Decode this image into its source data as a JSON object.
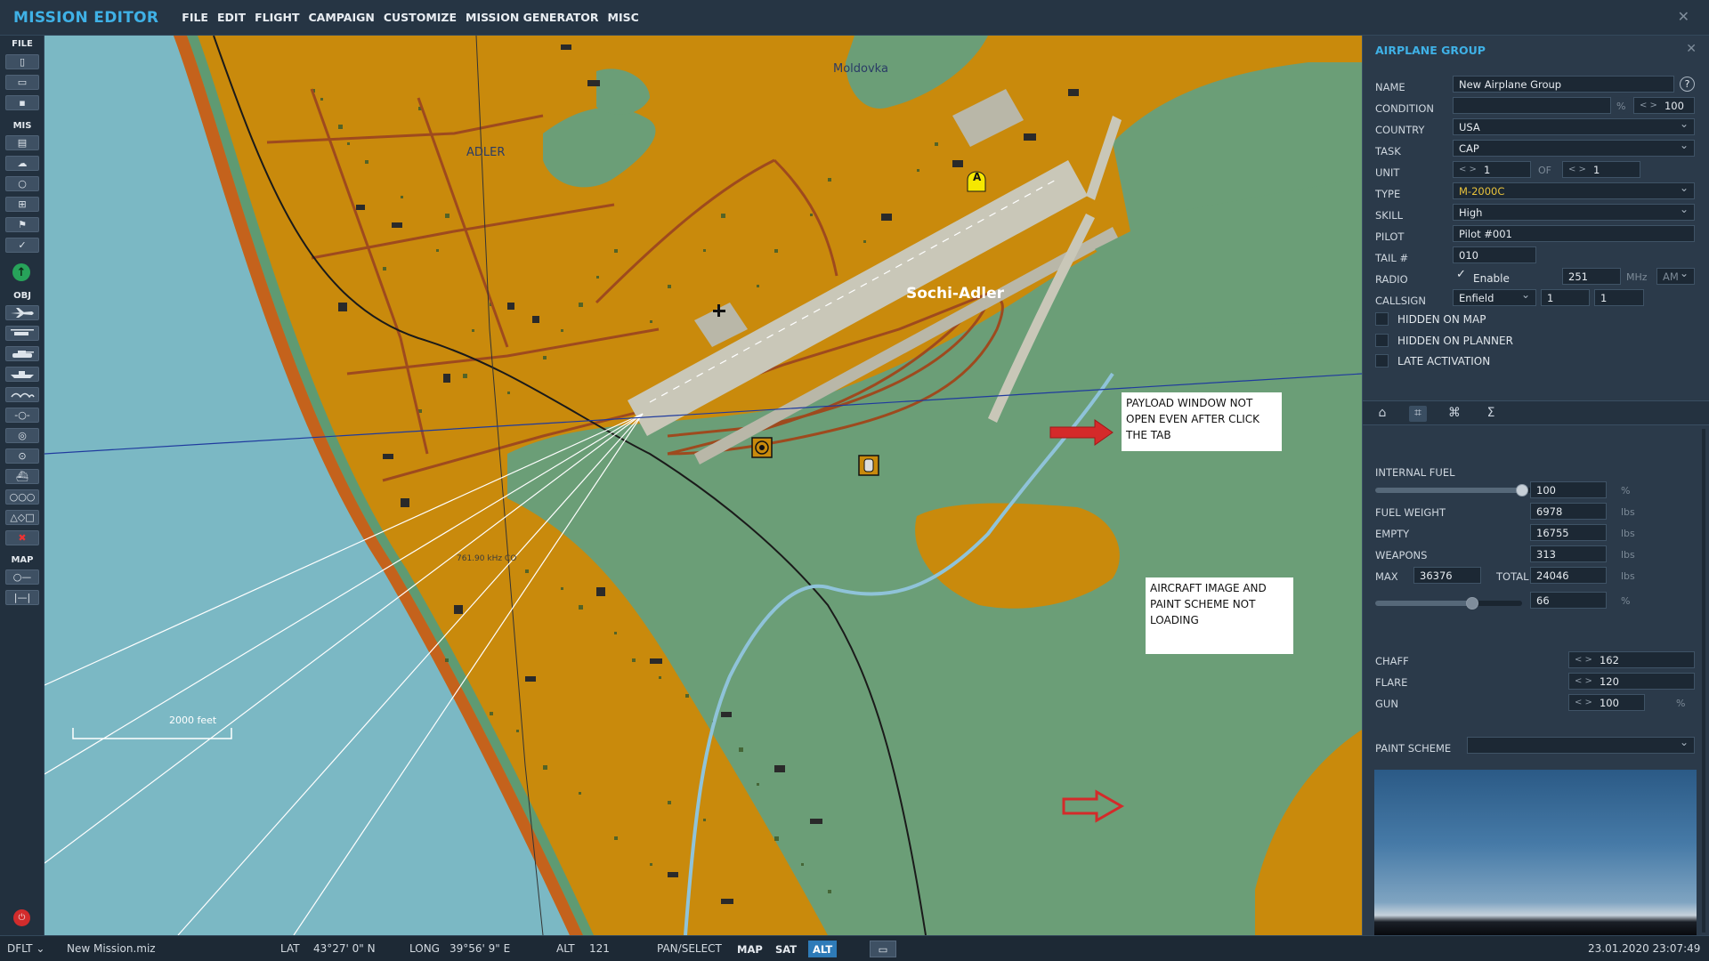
{
  "app": {
    "title": "MISSION EDITOR"
  },
  "menu": [
    "FILE",
    "EDIT",
    "FLIGHT",
    "CAMPAIGN",
    "CUSTOMIZE",
    "MISSION GENERATOR",
    "MISC"
  ],
  "toolbar": {
    "sections": {
      "file": "FILE",
      "mis": "MIS",
      "obj": "OBJ",
      "map": "MAP"
    }
  },
  "map": {
    "labels": {
      "town1": "Moldovka",
      "town2": "ADLER",
      "airfield": "Sochi-Adler",
      "waypoint": "A",
      "frequency": "761.90 kHz CO",
      "scale": "2000 feet"
    },
    "annotations": {
      "payload": "PAYLOAD WINDOW NOT OPEN EVEN AFTER CLICK THE TAB",
      "image": "AIRCRAFT IMAGE AND PAINT SCHEME NOT LOADING"
    },
    "colors": {
      "sea": "#7bb8c4",
      "land": "#c98a0c",
      "green": "#6b9e77",
      "road": "#9e4a1e",
      "runway": "#c9c7b8"
    }
  },
  "panel": {
    "title": "AIRPLANE GROUP",
    "name_label": "NAME",
    "name_value": "New Airplane Group",
    "help": "?",
    "condition_label": "CONDITION",
    "condition_value": "",
    "condition_unit": "%",
    "condition_pct": "100",
    "country_label": "COUNTRY",
    "country_value": "USA",
    "task_label": "TASK",
    "task_value": "CAP",
    "unit_label": "UNIT",
    "unit_value": "1",
    "unit_of": "OF",
    "unit_total": "1",
    "type_label": "TYPE",
    "type_value": "M-2000C",
    "skill_label": "SKILL",
    "skill_value": "High",
    "pilot_label": "PILOT",
    "pilot_value": "Pilot #001",
    "tail_label": "TAIL #",
    "tail_value": "010",
    "radio_label": "RADIO",
    "radio_enable": "Enable",
    "radio_freq": "251",
    "radio_unit": "MHz",
    "radio_mod": "AM",
    "callsign_label": "CALLSIGN",
    "callsign_value": "Enfield",
    "callsign_n1": "1",
    "callsign_n2": "1",
    "hidden_map": "HIDDEN ON MAP",
    "hidden_planner": "HIDDEN ON PLANNER",
    "late_activation": "LATE ACTIVATION",
    "payload": {
      "internal_fuel_label": "INTERNAL FUEL",
      "internal_fuel_value": "100",
      "internal_fuel_unit": "%",
      "internal_fuel_level": 1.0,
      "fuel_weight_label": "FUEL WEIGHT",
      "fuel_weight_value": "6978",
      "empty_label": "EMPTY",
      "empty_value": "16755",
      "weapons_label": "WEAPONS",
      "weapons_value": "313",
      "max_label": "MAX",
      "max_value": "36376",
      "total_label": "TOTAL",
      "total_value": "24046",
      "load_pct_value": "66",
      "load_pct_unit": "%",
      "load_level": 0.66,
      "lbs": "lbs",
      "chaff_label": "CHAFF",
      "chaff_value": "162",
      "flare_label": "FLARE",
      "flare_value": "120",
      "gun_label": "GUN",
      "gun_value": "100",
      "gun_unit": "%",
      "paint_scheme_label": "PAINT SCHEME",
      "paint_scheme_value": ""
    }
  },
  "status": {
    "mode": "DFLT",
    "file": "New Mission.miz",
    "lat_label": "LAT",
    "lat_value": "43°27' 0\" N",
    "long_label": "LONG",
    "long_value": "39°56' 9\" E",
    "alt_label": "ALT",
    "alt_value": "121",
    "pan_select": "PAN/SELECT",
    "map_btn": "MAP",
    "sat_btn": "SAT",
    "alt_btn": "ALT",
    "datetime": "23.01.2020 23:07:49"
  }
}
